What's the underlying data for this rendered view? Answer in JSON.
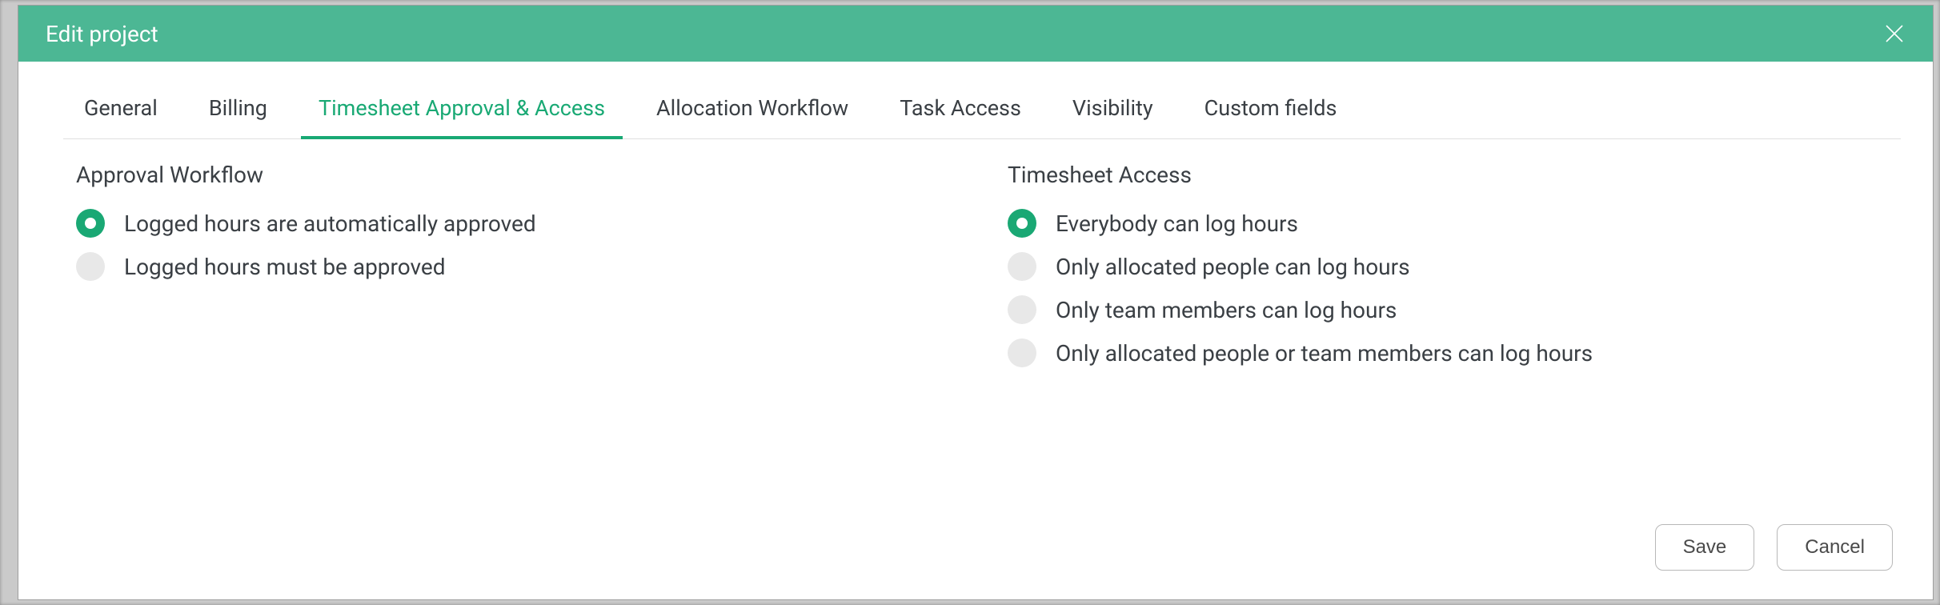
{
  "modal": {
    "title": "Edit project",
    "tabs": [
      {
        "label": "General",
        "active": false
      },
      {
        "label": "Billing",
        "active": false
      },
      {
        "label": "Timesheet Approval & Access",
        "active": true
      },
      {
        "label": "Allocation Workflow",
        "active": false
      },
      {
        "label": "Task Access",
        "active": false
      },
      {
        "label": "Visibility",
        "active": false
      },
      {
        "label": "Custom fields",
        "active": false
      }
    ],
    "approval_section": {
      "title": "Approval Workflow",
      "options": [
        {
          "label": "Logged hours are automatically approved",
          "selected": true
        },
        {
          "label": "Logged hours must be approved",
          "selected": false
        }
      ]
    },
    "access_section": {
      "title": "Timesheet Access",
      "options": [
        {
          "label": "Everybody can log hours",
          "selected": true
        },
        {
          "label": "Only allocated people can log hours",
          "selected": false
        },
        {
          "label": "Only team members can log hours",
          "selected": false
        },
        {
          "label": "Only allocated people or team members can log hours",
          "selected": false
        }
      ]
    },
    "buttons": {
      "save": "Save",
      "cancel": "Cancel"
    }
  },
  "colors": {
    "accent": "#1aa874",
    "header": "#4cb794"
  }
}
